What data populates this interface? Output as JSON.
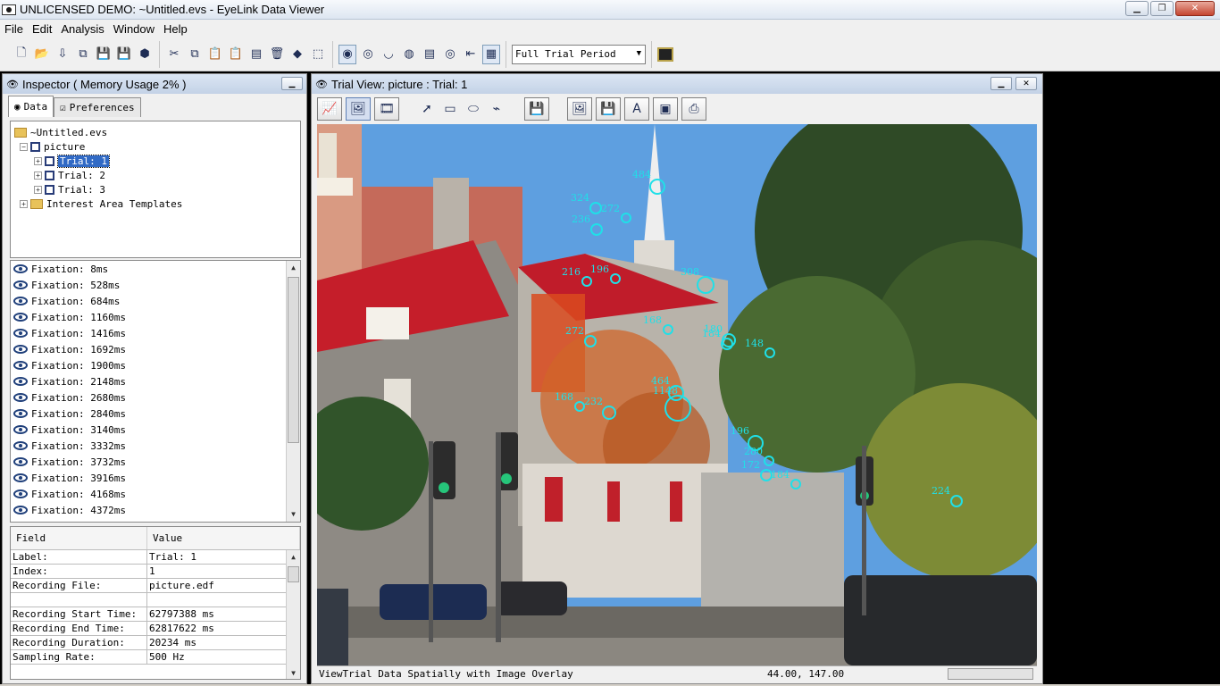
{
  "window": {
    "title": "UNLICENSED DEMO: ~Untitled.evs - EyeLink Data Viewer",
    "min_label": "▁",
    "max_label": "❐",
    "close_label": "✕"
  },
  "menu": [
    "File",
    "Edit",
    "Analysis",
    "Window",
    "Help"
  ],
  "toolbar": {
    "period_select": "Full Trial Period"
  },
  "inspector": {
    "title": "Inspector ( Memory Usage 2% )",
    "tabs": [
      {
        "label": "Data",
        "active": true
      },
      {
        "label": "Preferences",
        "active": false
      }
    ],
    "tree": {
      "root": "~Untitled.evs",
      "session": "picture",
      "trials": [
        "Trial: 1",
        "Trial: 2",
        "Trial: 3"
      ],
      "templates": "Interest Area Templates"
    },
    "fixations": [
      "Fixation: 8ms",
      "Fixation: 528ms",
      "Fixation: 684ms",
      "Fixation: 1160ms",
      "Fixation: 1416ms",
      "Fixation: 1692ms",
      "Fixation: 1900ms",
      "Fixation: 2148ms",
      "Fixation: 2680ms",
      "Fixation: 2840ms",
      "Fixation: 3140ms",
      "Fixation: 3332ms",
      "Fixation: 3732ms",
      "Fixation: 3916ms",
      "Fixation: 4168ms",
      "Fixation: 4372ms"
    ],
    "props_header": {
      "field": "Field",
      "value": "Value"
    },
    "props": [
      {
        "k": "Label:",
        "v": "Trial: 1"
      },
      {
        "k": "Index:",
        "v": "1"
      },
      {
        "k": "Recording File:",
        "v": "picture.edf"
      },
      {
        "k": "",
        "v": ""
      },
      {
        "k": "Recording Start Time:",
        "v": "62797388 ms"
      },
      {
        "k": "Recording End Time:",
        "v": "62817622 ms"
      },
      {
        "k": "Recording Duration:",
        "v": "20234 ms"
      },
      {
        "k": "Sampling Rate:",
        "v": "500 Hz"
      }
    ]
  },
  "trialview": {
    "title": "Trial View: picture : Trial: 1",
    "status": "ViewTrial Data Spatially with Image Overlay",
    "coords": "44.00, 147.00",
    "fixation_color": "#1fe0e8",
    "fixation_labels": [
      "484",
      "324",
      "236",
      "272",
      "216",
      "196",
      "308",
      "272",
      "168",
      "180",
      "184",
      "148",
      "464",
      "1148",
      "168",
      "232",
      "196",
      "280",
      "172",
      "184",
      "224"
    ]
  }
}
